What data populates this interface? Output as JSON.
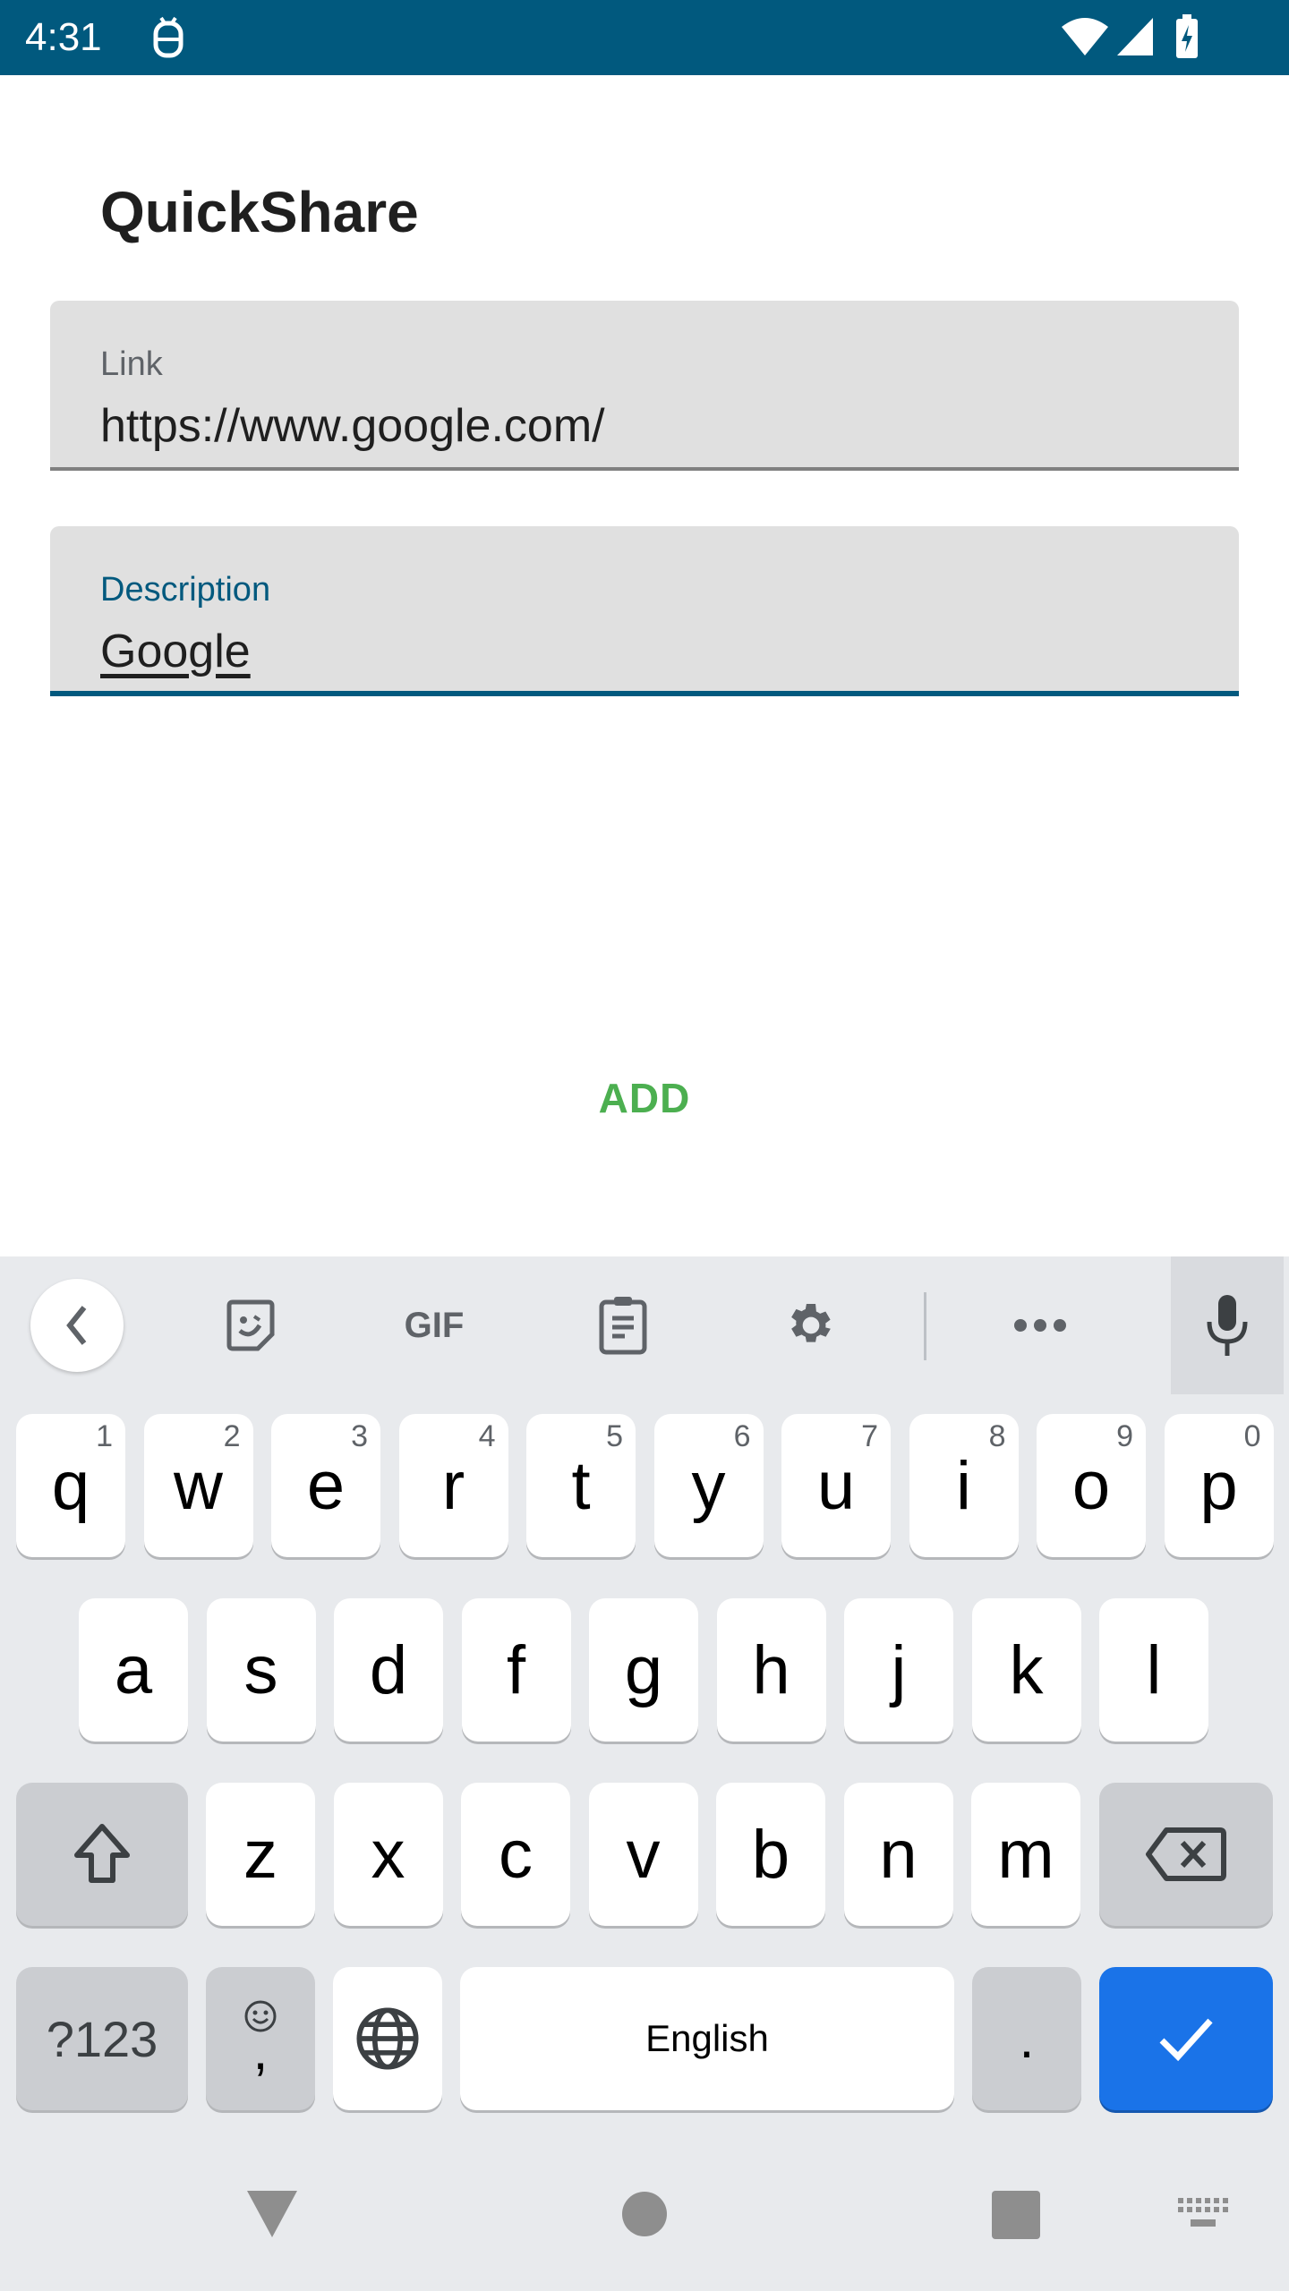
{
  "status_bar": {
    "time": "4:31",
    "icons": [
      "debug-icon",
      "wifi-icon",
      "signal-icon",
      "battery-charging-icon"
    ]
  },
  "app": {
    "title": "QuickShare"
  },
  "form": {
    "link": {
      "label": "Link",
      "value": "https://www.google.com/"
    },
    "description": {
      "label": "Description",
      "value": "Google"
    },
    "add_label": "ADD"
  },
  "colors": {
    "primary": "#01597E",
    "add_green": "#4CAF50",
    "enter_blue": "#1A73E8"
  },
  "keyboard": {
    "toolbar": [
      "back-icon",
      "sticker-icon",
      "gif-icon",
      "clipboard-icon",
      "settings-icon",
      "more-icon",
      "microphone-icon"
    ],
    "gif_label": "GIF",
    "row1": [
      {
        "k": "q",
        "h": "1"
      },
      {
        "k": "w",
        "h": "2"
      },
      {
        "k": "e",
        "h": "3"
      },
      {
        "k": "r",
        "h": "4"
      },
      {
        "k": "t",
        "h": "5"
      },
      {
        "k": "y",
        "h": "6"
      },
      {
        "k": "u",
        "h": "7"
      },
      {
        "k": "i",
        "h": "8"
      },
      {
        "k": "o",
        "h": "9"
      },
      {
        "k": "p",
        "h": "0"
      }
    ],
    "row2": [
      "a",
      "s",
      "d",
      "f",
      "g",
      "h",
      "j",
      "k",
      "l"
    ],
    "row3": [
      "z",
      "x",
      "c",
      "v",
      "b",
      "n",
      "m"
    ],
    "symbols_label": "?123",
    "comma_label": ",",
    "space_label": "English",
    "period_label": "."
  }
}
